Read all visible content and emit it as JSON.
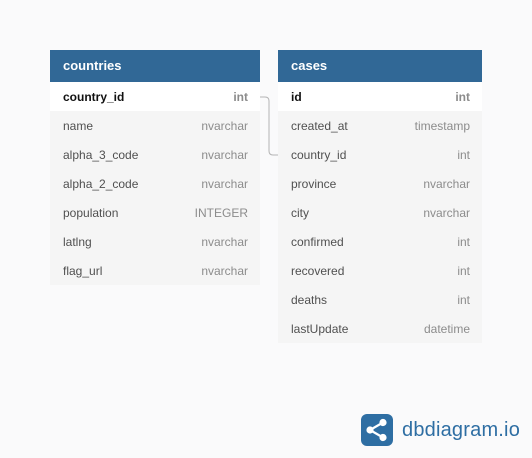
{
  "tables": {
    "countries": {
      "name": "countries",
      "fields": [
        {
          "name": "country_id",
          "type": "int",
          "pk": true
        },
        {
          "name": "name",
          "type": "nvarchar"
        },
        {
          "name": "alpha_3_code",
          "type": "nvarchar"
        },
        {
          "name": "alpha_2_code",
          "type": "nvarchar"
        },
        {
          "name": "population",
          "type": "INTEGER"
        },
        {
          "name": "latlng",
          "type": "nvarchar"
        },
        {
          "name": "flag_url",
          "type": "nvarchar"
        }
      ]
    },
    "cases": {
      "name": "cases",
      "fields": [
        {
          "name": "id",
          "type": "int",
          "pk": true
        },
        {
          "name": "created_at",
          "type": "timestamp"
        },
        {
          "name": "country_id",
          "type": "int"
        },
        {
          "name": "province",
          "type": "nvarchar"
        },
        {
          "name": "city",
          "type": "nvarchar"
        },
        {
          "name": "confirmed",
          "type": "int"
        },
        {
          "name": "recovered",
          "type": "int"
        },
        {
          "name": "deaths",
          "type": "int"
        },
        {
          "name": "lastUpdate",
          "type": "datetime"
        }
      ]
    }
  },
  "colors": {
    "header": "#316896",
    "link": "#b4b4b4",
    "brand": "#2e6ea3"
  },
  "brand": {
    "text": "dbdiagram.io"
  }
}
